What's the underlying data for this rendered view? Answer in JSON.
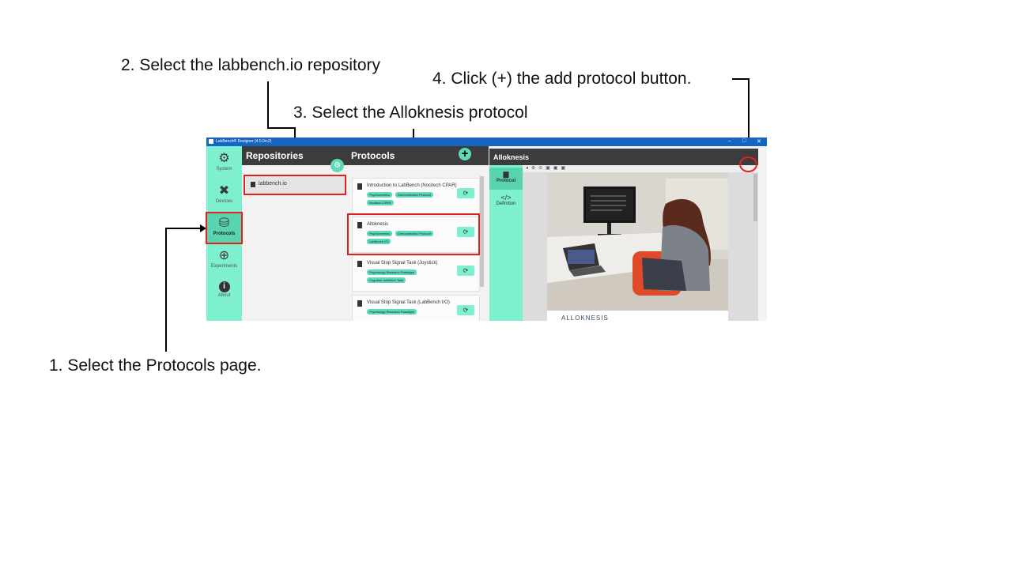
{
  "annotations": {
    "step1": "1. Select the Protocols page.",
    "step2": "2. Select the labbench.io repository",
    "step3": "3. Select the Alloknesis protocol",
    "step4": "4. Click (+) the add protocol button."
  },
  "window": {
    "title": "LabBench® Designer (4.5.0rc2)",
    "controls": [
      "–",
      "□",
      "✕"
    ]
  },
  "nav": {
    "items": [
      {
        "label": "System",
        "icon": "gear-icon"
      },
      {
        "label": "Devices",
        "icon": "tools-icon"
      },
      {
        "label": "Protocols",
        "icon": "database-icon",
        "active": true
      },
      {
        "label": "Experiments",
        "icon": "globe-icon"
      },
      {
        "label": "About",
        "icon": "info-icon"
      }
    ]
  },
  "repositories": {
    "header": "Repositories",
    "items": [
      "labbench.io"
    ]
  },
  "protocols": {
    "header": "Protocols",
    "items": [
      {
        "name": "Introduction to LabBench (Nocitech CPAR)",
        "tags": [
          "Psychometrics",
          "Demonstration Protocol",
          "Nocitech CPAR"
        ]
      },
      {
        "name": "Alloknesis",
        "tags": [
          "Psychometrics",
          "Demonstration Protocol",
          "LabBench I/O"
        ]
      },
      {
        "name": "Visual Stop Signal Task (Joystick)",
        "tags": [
          "Psychology Research Paradigm",
          "Cognitive Inhibition Task"
        ]
      },
      {
        "name": "Visual Stop Signal Task (LabBench I/O)",
        "tags": [
          "Psychology Research Paradigm"
        ]
      }
    ]
  },
  "detail": {
    "header": "Alloknesis",
    "add_button": "+",
    "tabs": [
      {
        "label": "Protocol",
        "icon": "document-icon",
        "active": true
      },
      {
        "label": "Definition",
        "icon": "code-icon"
      }
    ],
    "document_title": "ALLOKNESIS"
  },
  "colors": {
    "accent": "#7ef0d0",
    "accent_active": "#58d4b0",
    "header_dark": "#3c3c3c",
    "titlebar": "#1565c0",
    "highlight": "#e32020"
  }
}
